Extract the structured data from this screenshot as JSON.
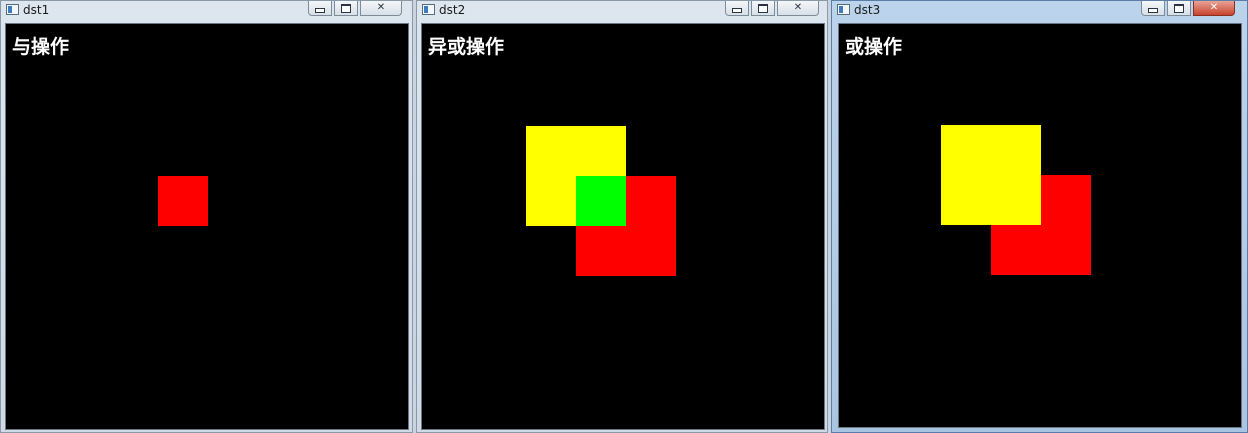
{
  "windows": [
    {
      "title": "dst1",
      "label": "与操作"
    },
    {
      "title": "dst2",
      "label": "异或操作"
    },
    {
      "title": "dst3",
      "label": "或操作"
    }
  ],
  "title_buttons": {
    "minimize": "—",
    "maximize": "□",
    "close": "✕"
  },
  "colors": {
    "yellow": "#ffff00",
    "red": "#ff0000",
    "green": "#00ff00",
    "background": "#000000"
  }
}
